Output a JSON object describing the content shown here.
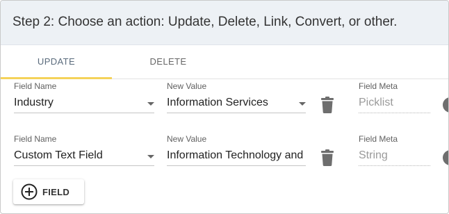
{
  "header": {
    "title": "Step 2: Choose an action: Update, Delete, Link, Convert, or other."
  },
  "tabs": [
    {
      "label": "UPDATE",
      "active": true
    },
    {
      "label": "DELETE",
      "active": false
    }
  ],
  "rows": [
    {
      "field_name_label": "Field Name",
      "field_name_value": "Industry",
      "new_value_label": "New Value",
      "new_value_value": "Information Services",
      "field_meta_label": "Field Meta",
      "field_meta_value": "Picklist"
    },
    {
      "field_name_label": "Field Name",
      "field_name_value": "Custom Text Field",
      "new_value_label": "New Value",
      "new_value_value": "Information Technology and",
      "field_meta_label": "Field Meta",
      "field_meta_value": "String"
    }
  ],
  "add_button": {
    "label": "FIELD"
  },
  "colors": {
    "header_bg": "#edf1f5",
    "active_tab_underline": "#f5d25a",
    "icon_gray": "#6e6e6e"
  }
}
